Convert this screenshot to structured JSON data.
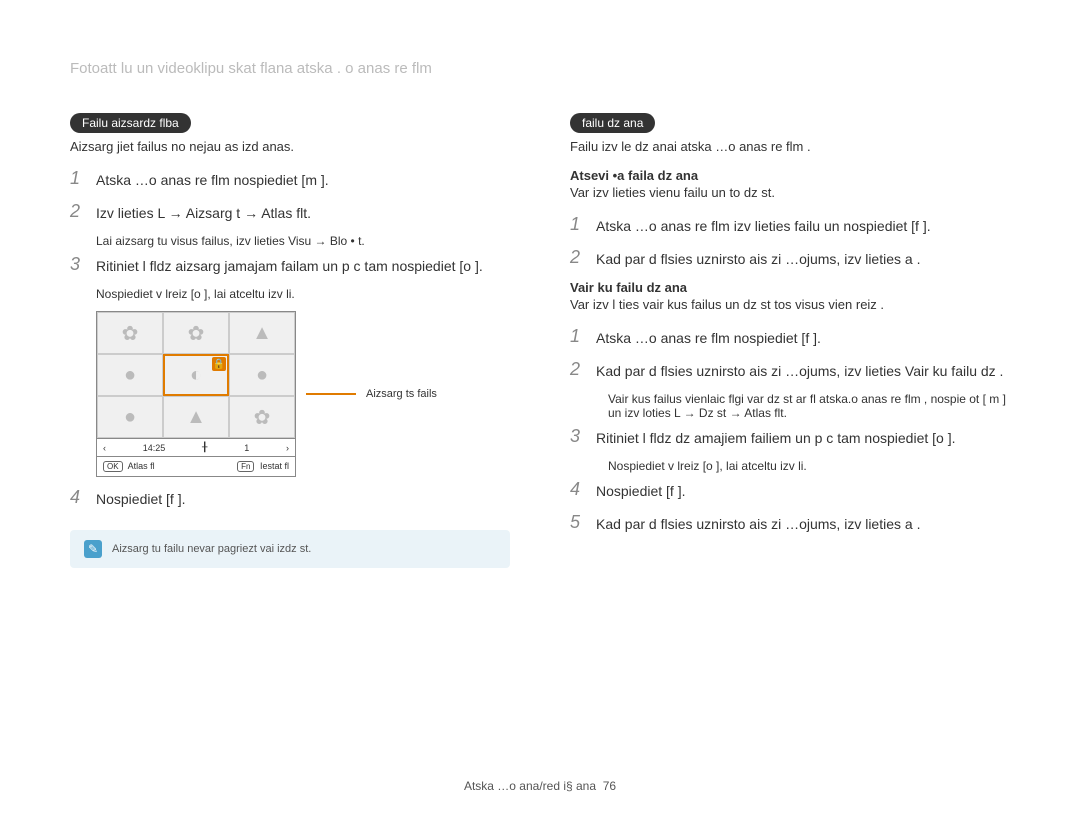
{
  "header": "Fotoatt  lu un videoklipu skat ﬂana atska . o anas re  ﬂm",
  "left": {
    "badge": "Failu aizsardz ﬂba",
    "intro": "Aizsarg  jiet failus no nejau as izd   anas.",
    "steps": [
      {
        "n": "1",
        "t": "Atska …o anas re ﬂm  nospiediet [m     ]."
      },
      {
        "n": "2",
        "t": "Izv  lieties L     → Aizsarg  t → Atlas ﬂt."
      },
      {
        "n": "",
        "t": ""
      },
      {
        "n": "3",
        "t": "Ritiniet l ﬂdz aizsarg jamajam failam un p c tam nospiediet [o   ]."
      },
      {
        "n": "4",
        "t": "Nospiediet [f   ]."
      }
    ],
    "sub1": "Lai aizsarg  tu visus failus, izv  lieties Visu → Blo • t.",
    "sub2": "Nospiediet v  lreiz [o   ], lai atceltu izv  li.",
    "callout": "Aizsarg  ts fails",
    "thumb": {
      "time": "14:25",
      "count": "1",
      "left_btn": "Atlas ﬂ",
      "right_btn": "Iestat ﬂ",
      "ok": "OK",
      "fn": "Fn"
    },
    "note": "Aizsarg  tu failu nevar pagriezt vai izdz  st."
  },
  "right": {
    "badge": "failu dz    ana",
    "intro": "Failu izv  le dz   anai atska …o anas re ﬂm .",
    "single": {
      "title": "Atsevi  •a faila dz   ana",
      "desc": "Var izv  lieties vienu failu un to dz  st.",
      "steps": [
        {
          "n": "1",
          "t": "Atska …o anas re ﬂm  izv  lieties failu un nospiediet [f   ]."
        },
        {
          "n": "2",
          "t": "Kad par  d ﬂsies uznirsto ais zi …ojums, izv  lieties a ."
        }
      ]
    },
    "multi": {
      "title": "Vair  ku failu dz    ana",
      "desc": "Var izv  l  ties vair  kus failus un dz  st tos visus vien  reiz .",
      "steps": [
        {
          "n": "1",
          "t": "Atska …o anas re ﬂm  nospiediet [f   ]."
        },
        {
          "n": "2",
          "t": "Kad par  d ﬂsies uznirsto ais zi …ojums, izv  lieties Vair  ku failu dz  ."
        },
        {
          "n": "3",
          "t": "Ritiniet l ﬂdz dz  amajiem failiem un p c tam nospiediet [o   ]."
        },
        {
          "n": "4",
          "t": "Nospiediet [f   ]."
        },
        {
          "n": "5",
          "t": "Kad par  d ﬂsies uznirsto ais zi …ojums, izv  lieties a ."
        }
      ],
      "sub1": "Vair  kus failus vienlaic ﬂgi var dz  st ar ﬂ atska.o anas re ﬂm , nospie ot [ m     ] un izv  loties L     → Dz  st → Atlas ﬂt.",
      "sub2": "Nospiediet v  lreiz [o   ], lai atceltu izv  li."
    }
  },
  "footer": {
    "text": "Atska …o ana/red i§  ana",
    "page": "76"
  }
}
